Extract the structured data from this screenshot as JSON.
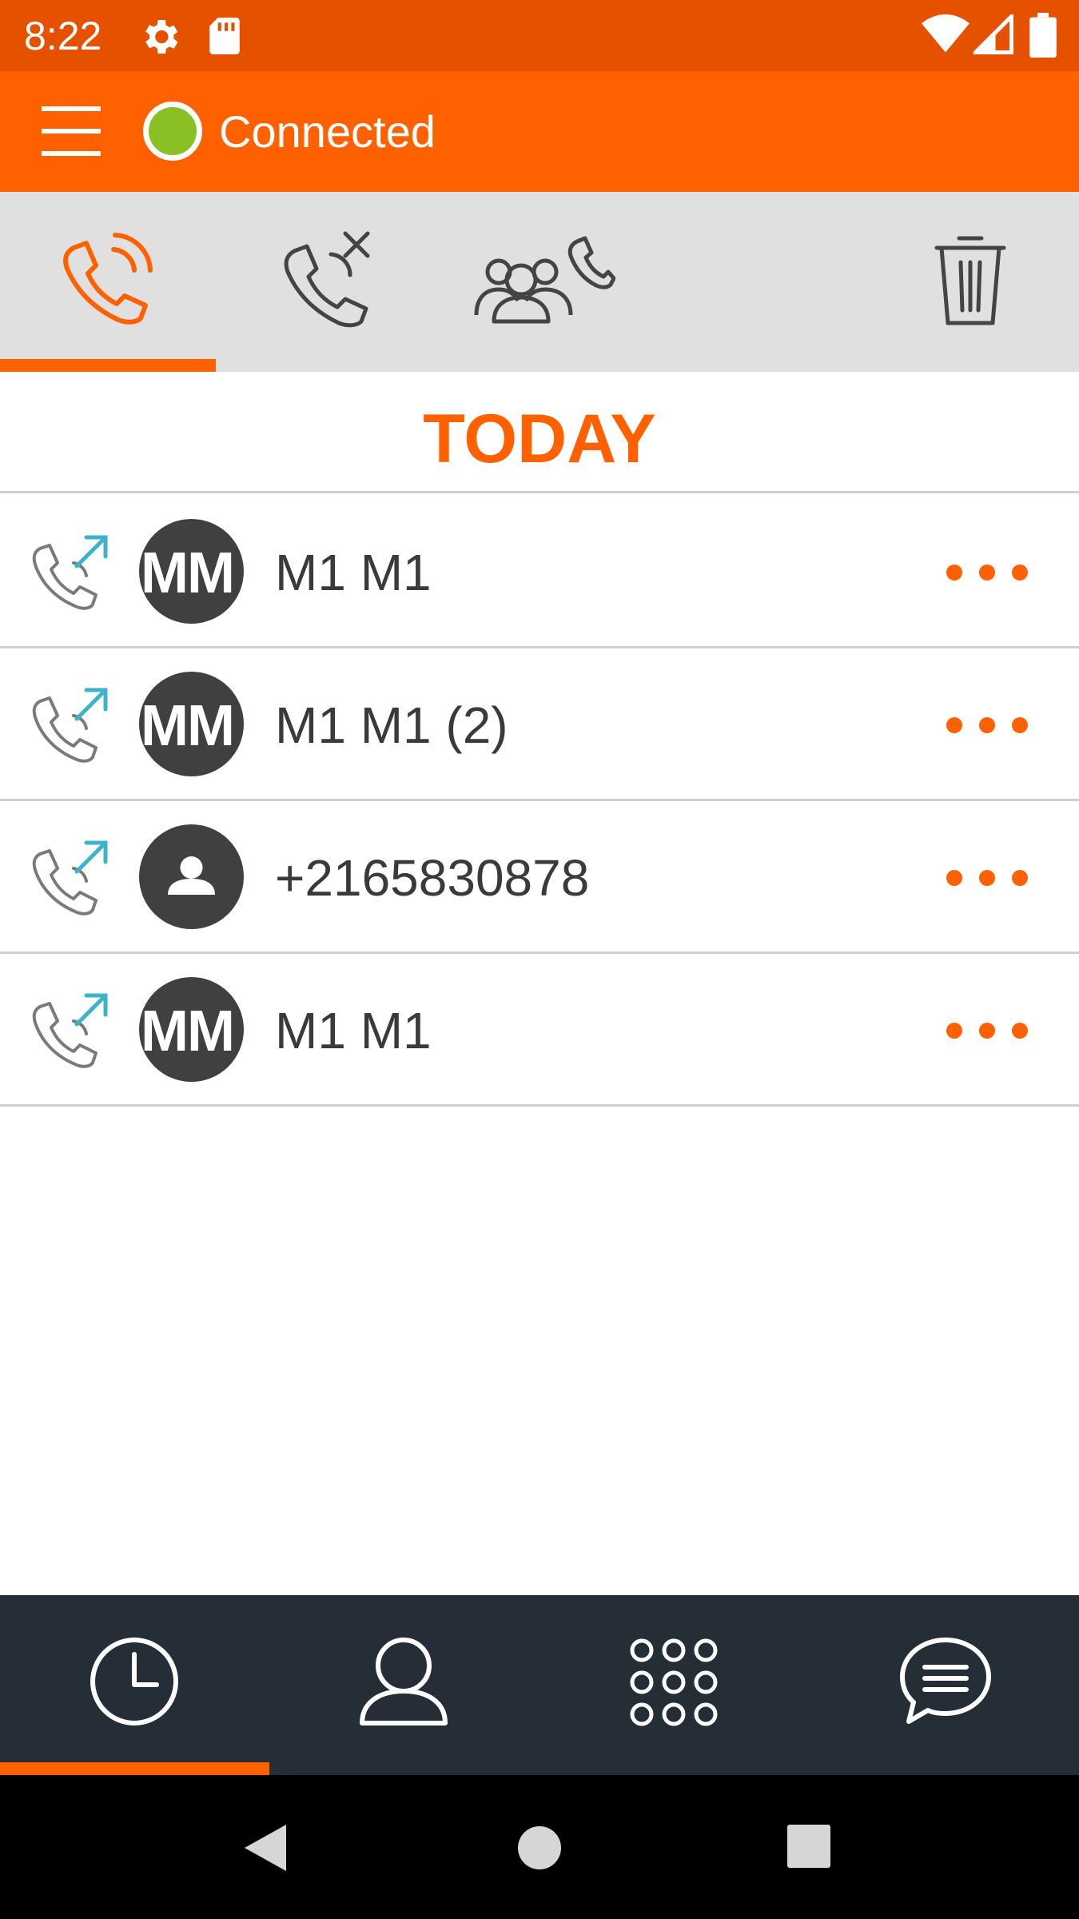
{
  "status_bar": {
    "time": "8:22",
    "icons": [
      "gear-icon",
      "sd-card-icon",
      "wifi-icon",
      "signal-icon",
      "battery-icon"
    ]
  },
  "app_bar": {
    "menu_icon": "hamburger-menu-icon",
    "connection_status": "Connected",
    "connection_color": "#8bc024"
  },
  "tabs": [
    {
      "name": "all-calls",
      "icon": "phone-calls-icon",
      "selected": true
    },
    {
      "name": "missed-calls",
      "icon": "missed-call-icon",
      "selected": false
    },
    {
      "name": "conference-calls",
      "icon": "group-call-icon",
      "selected": false
    },
    {
      "name": "delete",
      "icon": "trash-icon",
      "selected": false
    }
  ],
  "section": {
    "title": "TODAY"
  },
  "calls": [
    {
      "direction": "outgoing",
      "avatar_initials": "MM",
      "avatar_type": "initials",
      "name": "M1 M1"
    },
    {
      "direction": "outgoing",
      "avatar_initials": "MM",
      "avatar_type": "initials",
      "name": "M1 M1 (2)"
    },
    {
      "direction": "outgoing",
      "avatar_initials": "",
      "avatar_type": "person",
      "name": "+2165830878"
    },
    {
      "direction": "outgoing",
      "avatar_initials": "MM",
      "avatar_type": "initials",
      "name": "M1 M1"
    }
  ],
  "bottom_nav": [
    {
      "name": "history",
      "icon": "clock-icon",
      "selected": true
    },
    {
      "name": "contacts",
      "icon": "person-icon",
      "selected": false
    },
    {
      "name": "dialpad",
      "icon": "dialpad-icon",
      "selected": false
    },
    {
      "name": "messages",
      "icon": "chat-icon",
      "selected": false
    }
  ],
  "colors": {
    "accent": "#ff6101",
    "status_bar": "#e65100",
    "tab_bar": "#e0e0e0",
    "bottom_nav": "#252d36",
    "outgoing_arrow": "#3cb3c8"
  }
}
